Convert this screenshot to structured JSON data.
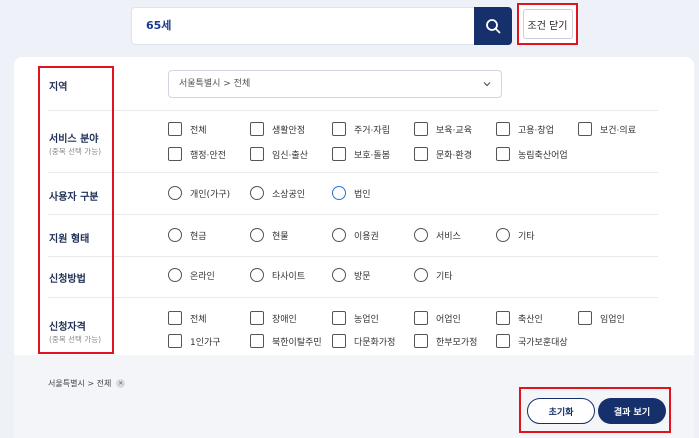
{
  "search": {
    "value": "65세"
  },
  "close_conditions_label": "조건 닫기",
  "region": {
    "label": "지역",
    "selected": "서울특별시 > 전체"
  },
  "service_field": {
    "label": "서비스 분야",
    "sub": "(중복 선택 가능)",
    "options": [
      "전체",
      "생활안정",
      "주거·자립",
      "보육·교육",
      "고용·창업",
      "보건·의료",
      "행정·안전",
      "임신·출산",
      "보호·돌봄",
      "문화·환경",
      "농림축산어업"
    ]
  },
  "user_type": {
    "label": "사용자 구분",
    "options": [
      "개인(가구)",
      "소상공인",
      "법인"
    ]
  },
  "support_type": {
    "label": "지원 형태",
    "options": [
      "현금",
      "현물",
      "이용권",
      "서비스",
      "기타"
    ]
  },
  "apply_method": {
    "label": "신청방법",
    "options": [
      "온라인",
      "타사이트",
      "방문",
      "기타"
    ]
  },
  "eligibility": {
    "label": "신청자격",
    "sub": "(중복 선택 가능)",
    "options": [
      "전체",
      "장애인",
      "농업인",
      "어업인",
      "축산인",
      "임업인",
      "1인가구",
      "북한이탈주민",
      "다문화가정",
      "한부모가정",
      "국가보훈대상"
    ]
  },
  "breadcrumb": "서울특별시 > 전체",
  "buttons": {
    "reset": "초기화",
    "result": "결과 보기"
  },
  "colors": {
    "navy": "#15306b",
    "highlight": "#e0141e",
    "radio_active": "#2f6fd6"
  }
}
